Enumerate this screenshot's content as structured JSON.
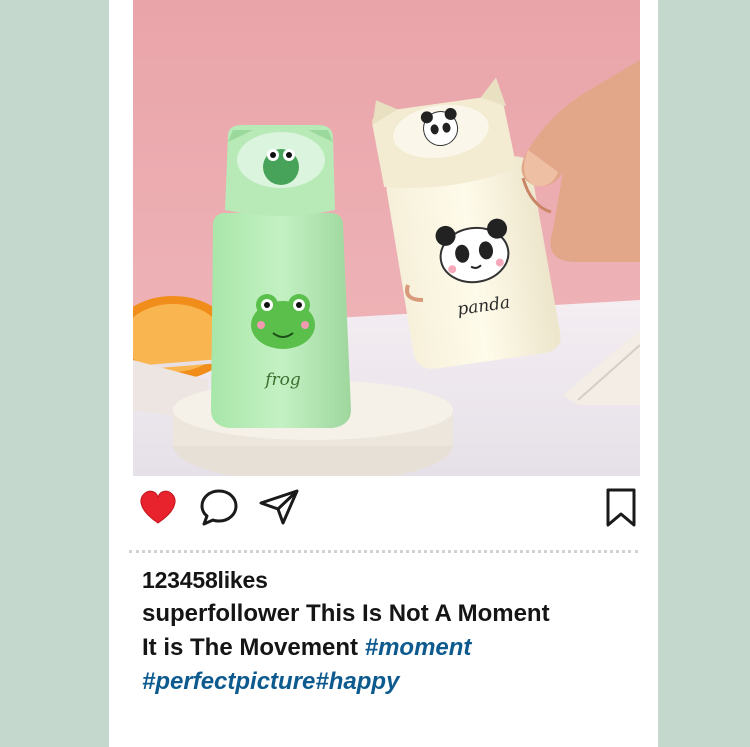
{
  "post": {
    "likes_text": "123458likes",
    "username": "superfollower",
    "caption_line1": "This Is Not A Moment",
    "caption_line2": "It is The Movement",
    "hashtags": [
      "#moment",
      "#perfectpicture",
      "#happy"
    ]
  },
  "photo": {
    "frog_bottle_label": "frog",
    "panda_bottle_label": "panda"
  },
  "icons": {
    "like": "heart-icon",
    "comment": "comment-bubble-icon",
    "share": "paper-plane-icon",
    "save": "bookmark-icon"
  },
  "colors": {
    "background": "#c5d8ce",
    "heart": "#e8232d",
    "hashtag": "#0d5a8f"
  }
}
